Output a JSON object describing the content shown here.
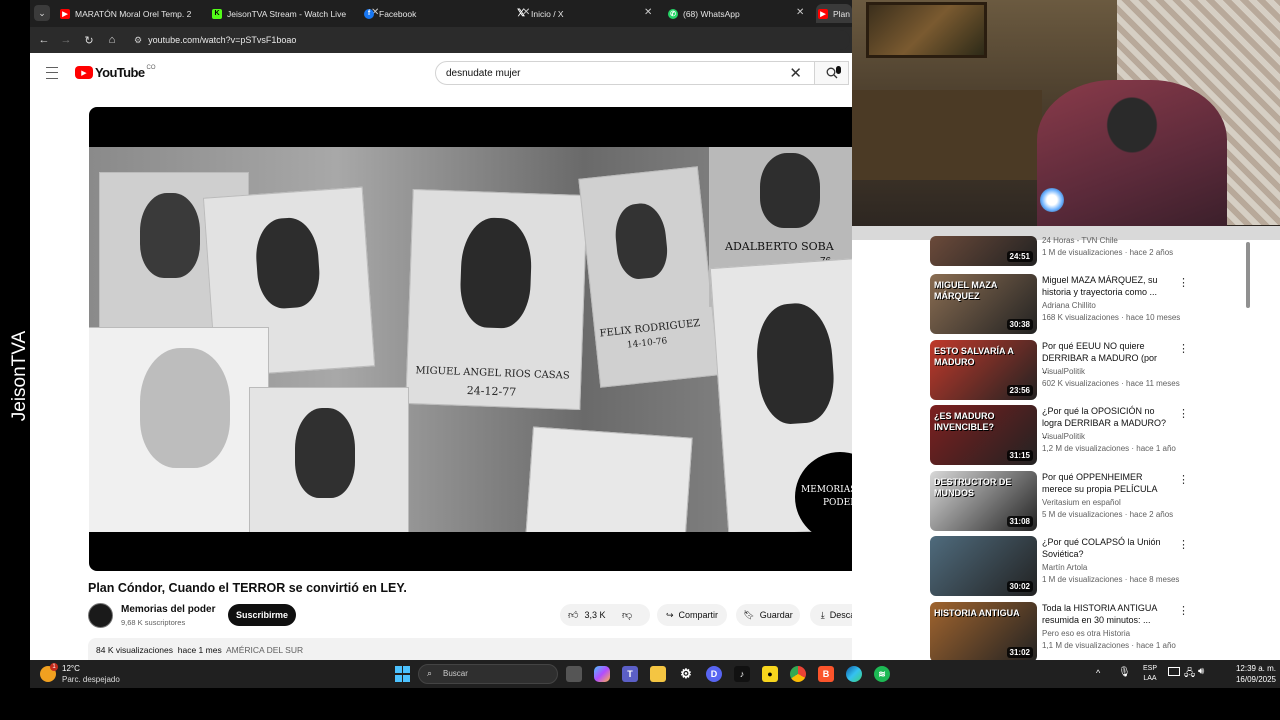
{
  "stream": {
    "watermark": "JeisonTVA"
  },
  "tabs": [
    {
      "label": "MARATÓN Moral Orel Temp. 2",
      "icon": "youtube-icon",
      "color": "#ff0000"
    },
    {
      "label": "JeisonTVA Stream - Watch Live",
      "icon": "kick-icon",
      "color": "#53fc18"
    },
    {
      "label": "Facebook",
      "icon": "facebook-icon",
      "color": "#1877f2"
    },
    {
      "label": "Inicio / X",
      "icon": "x-icon",
      "color": "#000000"
    },
    {
      "label": "(68) WhatsApp",
      "icon": "whatsapp-icon",
      "color": "#25d366"
    },
    {
      "label": "Plan",
      "icon": "youtube-icon",
      "color": "#ff0000"
    }
  ],
  "address": {
    "url": "youtube.com/watch?v=pSTvsF1boao"
  },
  "youtube": {
    "logo_text": "YouTube",
    "country": "CO",
    "search_value": "desnudate mujer"
  },
  "video": {
    "title": "Plan Cóndor, Cuando el TERROR se convirtió en LEY.",
    "photo_labels": [
      "MIGUEL ANGEL RIOS CASAS",
      "24-12-77",
      "FELIX RODRIGUEZ",
      "14-10-76",
      "ADALBERTO SOBA",
      "76"
    ],
    "badge_line1": "MEMORIAS DEL",
    "badge_line2": "PODER",
    "channel": "Memorias del poder",
    "subscribers": "9,68 K suscriptores",
    "subscribe": "Suscribirme",
    "likes": "3,3 K",
    "share": "Compartir",
    "save": "Guardar",
    "download": "Descargar",
    "more": "···",
    "views": "84 K visualizaciones",
    "ago": "hace 1 mes",
    "tag": "AMÉRICA DEL SUR"
  },
  "sidebar": [
    {
      "title": "",
      "channel": "24 Horas - TVN Chile",
      "meta": "1 M de visualizaciones · hace 2 años",
      "duration": "24:51",
      "color": "#6b4a3a"
    },
    {
      "title": "Miguel MAZA MÁRQUEZ, su historia y trayectoria como ...",
      "channel": "Adriana Chillito",
      "meta": "168 K visualizaciones · hace 10 meses",
      "duration": "30:38",
      "thumb_text": "MIGUEL MAZA MÁRQUEZ",
      "color": "#8a6d52"
    },
    {
      "title": "Por qué EEUU NO quiere DERRIBAR a MADURO (por ...",
      "channel": "VisualPolitik",
      "meta": "602 K visualizaciones · hace 11 meses",
      "duration": "23:56",
      "thumb_text": "ESTO SALVARÍA A MADURO",
      "color": "#c0392b"
    },
    {
      "title": "¿Por qué la OPOSICIÓN no logra DERRIBAR a MADURO? ...",
      "channel": "VisualPolitik",
      "meta": "1,2 M de visualizaciones · hace 1 año",
      "duration": "31:15",
      "thumb_text": "¿ES MADURO INVENCIBLE?",
      "color": "#7d1f1f"
    },
    {
      "title": "Por qué OPPENHEIMER merece su propia PELÍCULA",
      "channel": "Veritasium en español",
      "meta": "5 M de visualizaciones · hace 2 años",
      "duration": "31:08",
      "thumb_text": "DESTRUCTOR DE MUNDOS",
      "color": "#d8d8d8"
    },
    {
      "title": "¿Por qué COLAPSÓ la Unión Soviética?",
      "channel": "Martín Artola",
      "meta": "1 M de visualizaciones · hace 8 meses",
      "duration": "30:02",
      "color": "#4f6b7d"
    },
    {
      "title": "Toda la HISTORIA ANTIGUA resumida en 30 minutos: ...",
      "channel": "Pero eso es otra Historia",
      "meta": "1,1 M de visualizaciones · hace 1 año",
      "duration": "31:02",
      "thumb_text": "HISTORIA ANTIGUA",
      "color": "#a0642e"
    }
  ],
  "taskbar": {
    "temp": "12°C",
    "weather": "Parc. despejado",
    "search_placeholder": "Buscar",
    "lang1": "ESP",
    "lang2": "LAA",
    "time": "12:39 a. m.",
    "date": "16/09/2025",
    "weather_badge": "1"
  }
}
